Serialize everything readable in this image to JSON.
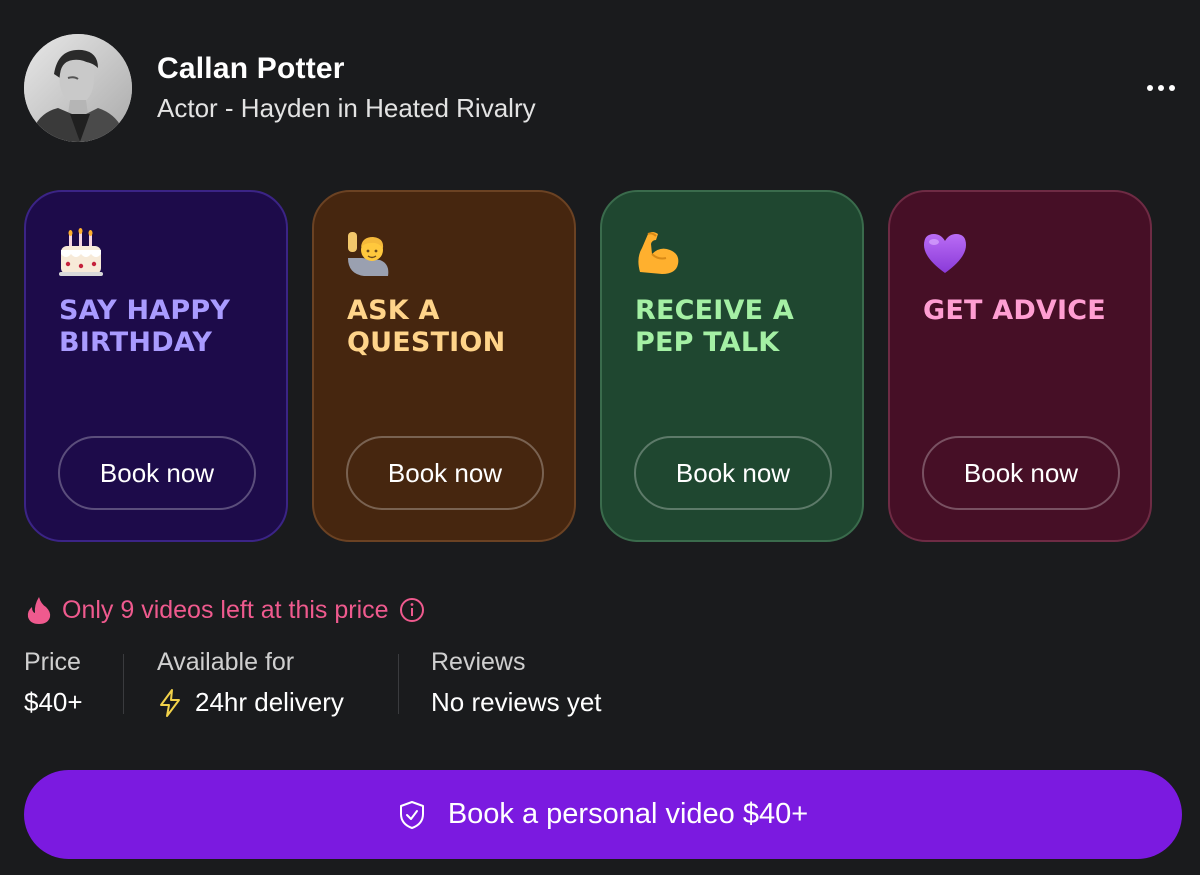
{
  "profile": {
    "name": "Callan Potter",
    "subtitle": "Actor - Hayden in Heated Rivalry",
    "avatar_icon": "profile-photo",
    "more_icon": "more-horizontal-icon"
  },
  "cards": [
    {
      "id": "birthday",
      "emoji": "birthday-cake-icon",
      "title": "SAY HAPPY BIRTHDAY",
      "button": "Book now",
      "bg": "#1d0b4a",
      "border": "#3b2486",
      "title_color": "#a99bff"
    },
    {
      "id": "question",
      "emoji": "raising-hand-icon",
      "title": "ASK A QUESTION",
      "button": "Book now",
      "bg": "#46260f",
      "border": "#6b4223",
      "title_color": "#ffd48a"
    },
    {
      "id": "pep-talk",
      "emoji": "flexed-biceps-icon",
      "title": "RECEIVE A PEP TALK",
      "button": "Book now",
      "bg": "#1f4730",
      "border": "#3a6b4c",
      "title_color": "#a4f0a4"
    },
    {
      "id": "advice",
      "emoji": "purple-heart-icon",
      "title": "GET ADVICE",
      "button": "Book now",
      "bg": "#460f26",
      "border": "#6e2b44",
      "title_color": "#ff9ed2"
    }
  ],
  "scarcity": {
    "text": "Only 9 videos left at this price",
    "color": "#ef5a8e"
  },
  "stats": {
    "price": {
      "label": "Price",
      "value": "$40+"
    },
    "availability": {
      "label": "Available for",
      "value": "24hr delivery",
      "icon": "lightning-icon"
    },
    "reviews": {
      "label": "Reviews",
      "value": "No reviews yet"
    }
  },
  "cta": {
    "label": "Book a personal video $40+",
    "icon": "shield-check-icon",
    "bg": "#7b1ae0"
  }
}
